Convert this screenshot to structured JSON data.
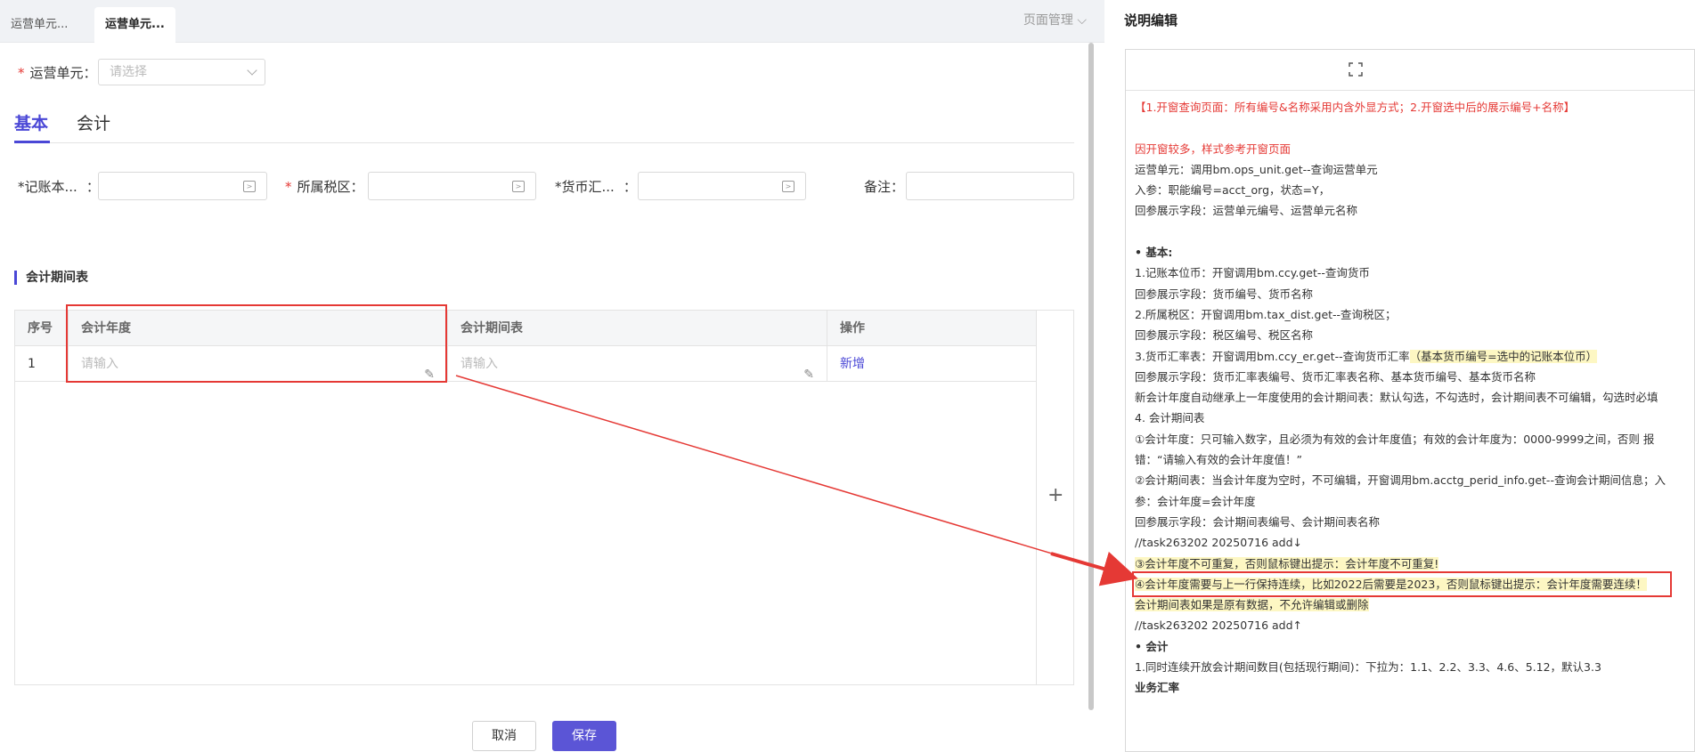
{
  "tabs": [
    {
      "label": "运营单元..."
    },
    {
      "label": "运营单元..."
    }
  ],
  "page_mgmt": "页面管理",
  "form": {
    "ops_unit_label": "运营单元：",
    "ops_unit_placeholder": "请选择",
    "fields": [
      {
        "label": "*记账本...",
        "colon": "："
      },
      {
        "label": "所属税区：",
        "required": "*"
      },
      {
        "label": "*货币汇...",
        "colon": "："
      },
      {
        "label": "备注："
      }
    ]
  },
  "subtabs": [
    "基本",
    "会计"
  ],
  "section_title": "会计期间表",
  "table": {
    "headers": [
      "序号",
      "会计年度",
      "会计期间表",
      "操作"
    ],
    "rows": [
      {
        "index": "1",
        "year_ph": "请输入",
        "period_ph": "请输入",
        "action": "新增"
      }
    ],
    "add_icon": "+"
  },
  "buttons": {
    "cancel": "取消",
    "save": "保存"
  },
  "right_panel": {
    "title": "说明编辑",
    "lines": [
      "【1.开窗查询页面：所有编号&名称采用内含外显方式；2.开窗选中后的展示编号+名称】",
      "",
      "因开窗较多，样式参考开窗页面",
      "运营单元：调用bm.ops_unit.get--查询运营单元",
      "入参：职能编号=acct_org，状态=Y，",
      "回参展示字段：运营单元编号、运营单元名称",
      "",
      "• 基本:",
      "1.记账本位币：开窗调用bm.ccy.get--查询货币",
      "  回参展示字段：货币编号、货币名称",
      "2.所属税区：开窗调用bm.tax_dist.get--查询税区；",
      " 回参展示字段：税区编号、税区名称",
      "3.货币汇率表：开窗调用bm.ccy_er.get--查询货币汇率",
      "（基本货币编号=选中的记账本位币）",
      "  回参展示字段：货币汇率表编号、货币汇率表名称、基本货币编号、基本货币名称",
      " 新会计年度自动继承上一年度使用的会计期间表：默认勾选，不勾选时，会计期间表不可编辑，勾选时必填",
      "4. 会计期间表",
      "  ①会计年度：只可输入数字，且必须为有效的会计年度值；有效的会计年度为：0000-9999之间，否则   报错：“请输入有效的会计年度值！”",
      "  ②会计期间表：当会计年度为空时，不可编辑，开窗调用bm.acctg_perid_info.get--查询会计期间信息；入参：会计年度=会计年度",
      "  回参展示字段：会计期间表编号、会计期间表名称",
      "//task263202 20250716 add↓",
      " ③会计年度不可重复，否则鼠标键出提示：会计年度不可重复!",
      " ④会计年度需要与上一行保持连续，比如2022后需要是2023，否则鼠标键出提示：会计年度需要连续！",
      " 会计期间表如果是原有数据，不允许编辑或删除",
      "//task263202 20250716 add↑",
      "• 会计",
      "1.同时连续开放会计期间数目(包括现行期间)：下拉为：1.1、2.2、3.3、4.6、5.12，默认3.3",
      "业务汇率"
    ]
  },
  "colors": {
    "accent": "#4a47d6",
    "highlight": "#e53935",
    "note_bg": "#fdf7c3"
  }
}
